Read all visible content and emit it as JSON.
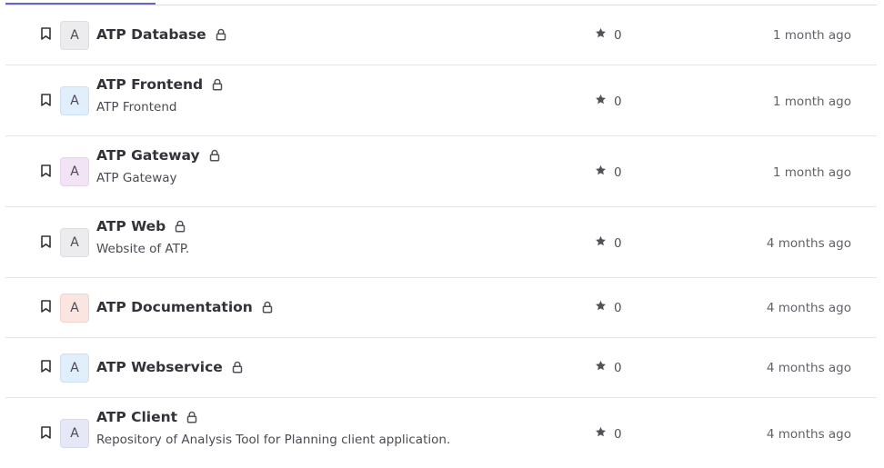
{
  "colors": {
    "accent": "#6366c7",
    "text": "#333238",
    "muted": "#626168",
    "divider": "#e6e6e8"
  },
  "icons": {
    "bookmark": "bookmark-icon",
    "lock": "lock-icon",
    "star": "star-icon"
  },
  "projects": [
    {
      "avatar": "A",
      "name": "ATP Database",
      "description": "",
      "stars": "0",
      "updated": "1 month ago"
    },
    {
      "avatar": "A",
      "name": "ATP Frontend",
      "description": "ATP Frontend",
      "stars": "0",
      "updated": "1 month ago"
    },
    {
      "avatar": "A",
      "name": "ATP Gateway",
      "description": "ATP Gateway",
      "stars": "0",
      "updated": "1 month ago"
    },
    {
      "avatar": "A",
      "name": "ATP Web",
      "description": "Website of ATP.",
      "stars": "0",
      "updated": "4 months ago"
    },
    {
      "avatar": "A",
      "name": "ATP Documentation",
      "description": "",
      "stars": "0",
      "updated": "4 months ago"
    },
    {
      "avatar": "A",
      "name": "ATP Webservice",
      "description": "",
      "stars": "0",
      "updated": "4 months ago"
    },
    {
      "avatar": "A",
      "name": "ATP Client",
      "description": "Repository of Analysis Tool for Planning client application.",
      "stars": "0",
      "updated": "4 months ago"
    }
  ]
}
